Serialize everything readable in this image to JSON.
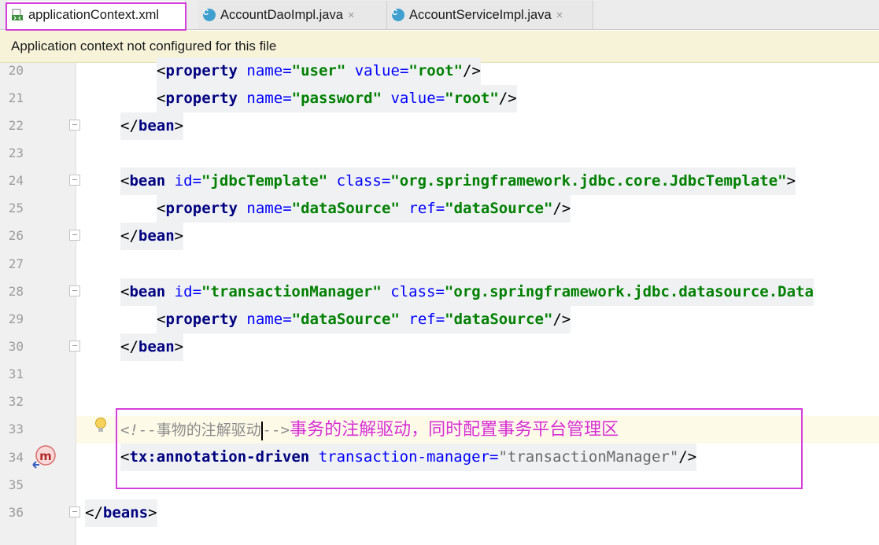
{
  "tabs": [
    {
      "label": "applicationContext.xml",
      "icon": "xml-file-icon",
      "active": true
    },
    {
      "label": "AccountDaoImpl.java",
      "icon": "java-class-icon",
      "active": false
    },
    {
      "label": "AccountServiceImpl.java",
      "icon": "java-class-icon",
      "active": false
    }
  ],
  "tab_close_glyph": "×",
  "class_icon_letter": "C",
  "notification": "Application context not configured for this file",
  "line_numbers": [
    "20",
    "21",
    "22",
    "23",
    "24",
    "25",
    "26",
    "27",
    "28",
    "29",
    "30",
    "31",
    "32",
    "33",
    "34",
    "35",
    "36"
  ],
  "code": {
    "l20": {
      "tag": "property",
      "a1": "name",
      "v1": "\"user\"",
      "a2": "value",
      "v2": "\"root\""
    },
    "l21": {
      "tag": "property",
      "a1": "name",
      "v1": "\"password\"",
      "a2": "value",
      "v2": "\"root\""
    },
    "l22": {
      "tag": "bean"
    },
    "l24": {
      "tag": "bean",
      "a1": "id",
      "v1": "\"jdbcTemplate\"",
      "a2": "class",
      "v2": "\"org.springframework.jdbc.core.JdbcTemplate\""
    },
    "l25": {
      "tag": "property",
      "a1": "name",
      "v1": "\"dataSource\"",
      "a2": "ref",
      "v2": "\"dataSource\""
    },
    "l26": {
      "tag": "bean"
    },
    "l28": {
      "tag": "bean",
      "a1": "id",
      "v1": "\"transactionManager\"",
      "a2": "class",
      "v2": "\"org.springframework.jdbc.datasource.Data"
    },
    "l29": {
      "tag": "property",
      "a1": "name",
      "v1": "\"dataSource\"",
      "a2": "ref",
      "v2": "\"dataSource\""
    },
    "l30": {
      "tag": "bean"
    },
    "l33": {
      "comment_open": "<!--",
      "comment_text": "事物的注解驱动",
      "comment_close": "-->"
    },
    "l34": {
      "tag": "tx:annotation-driven",
      "a1": "transaction-manager",
      "v1": "\"transactionManager\""
    },
    "l36": {
      "tag": "beans"
    }
  },
  "annotation_note": "事务的注解驱动，同时配置事务平台管理区",
  "colors": {
    "highlight_box": "#d43fd9",
    "annotation_text": "#d62ed6",
    "notice_bg": "#f6f3d8"
  }
}
